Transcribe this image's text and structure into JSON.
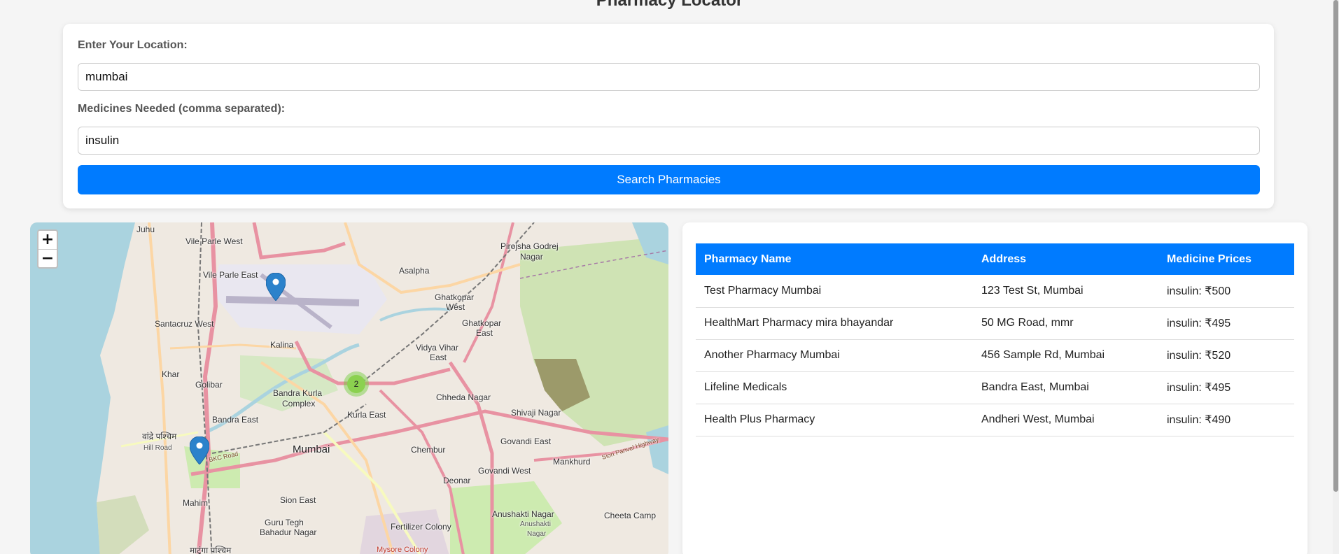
{
  "page": {
    "title": "Pharmacy Locator"
  },
  "form": {
    "location_label": "Enter Your Location:",
    "location_value": "mumbai",
    "medicines_label": "Medicines Needed (comma separated):",
    "medicines_value": "insulin",
    "search_button": "Search Pharmacies"
  },
  "map": {
    "zoom_in": "+",
    "zoom_out": "−",
    "cluster_count": "2",
    "marker_color": "#2b82cb",
    "labels": {
      "juhu": "Juhu",
      "vile_parle_west": "Vile Parle West",
      "vile_parle_east": "Vile Parle East",
      "santacruz_west": "Santacruz West",
      "kalina": "Kalina",
      "khar": "Khar",
      "golibar": "Golibar",
      "bandra_kurla": "Bandra Kurla",
      "complex": "Complex",
      "bandra_east": "Bandra East",
      "bandra_west_hindi": "वांद्रे पश्चिम",
      "hill_road": "Hill Road",
      "mumbai": "Mumbai",
      "kurla_east": "Kurla East",
      "chembur": "Chembur",
      "govandi_east": "Govandi East",
      "govandi_west": "Govandi West",
      "mankhurd": "Mankhurd",
      "deonar": "Deonar",
      "mahim": "Mahim",
      "sion_east": "Sion East",
      "guru_tegh": "Guru Tegh",
      "bahadur_nagar": "Bahadur Nagar",
      "matunga_west": "माटुंगा पश्चिम",
      "fertilizer_colony": "Fertilizer Colony",
      "anushakti_nagar": "Anushakti Nagar",
      "anushakti_nagar_small": "Anushakti",
      "anushakti_nagar_small2": "Nagar",
      "cheeta_camp": "Cheeta Camp",
      "asalpha": "Asalpha",
      "ghatkopar_west1": "Ghatkopar",
      "ghatkopar_west2": "West",
      "ghatkopar_east1": "Ghatkopar",
      "ghatkopar_east2": "East",
      "vidya_vihar1": "Vidya Vihar",
      "vidya_vihar2": "East",
      "chheda_nagar": "Chheda Nagar",
      "shivaji_nagar": "Shivaji Nagar",
      "pirojsha1": "Pirojsha Godrej",
      "pirojsha2": "Nagar",
      "sion_panvel": "Sion Panvel Highway",
      "bkc_road": "BKC Road",
      "mysore_colony": "Mysore Colony"
    }
  },
  "results": {
    "headers": [
      "Pharmacy Name",
      "Address",
      "Medicine Prices"
    ],
    "rows": [
      {
        "name": "Test Pharmacy Mumbai",
        "address": "123 Test St, Mumbai",
        "prices": "insulin: ₹500"
      },
      {
        "name": "HealthMart Pharmacy mira bhayandar",
        "address": "50 MG Road, mmr",
        "prices": "insulin: ₹495"
      },
      {
        "name": "Another Pharmacy Mumbai",
        "address": "456 Sample Rd, Mumbai",
        "prices": "insulin: ₹520"
      },
      {
        "name": "Lifeline Medicals",
        "address": "Bandra East, Mumbai",
        "prices": "insulin: ₹495"
      },
      {
        "name": "Health Plus Pharmacy",
        "address": "Andheri West, Mumbai",
        "prices": "insulin: ₹490"
      }
    ]
  },
  "colors": {
    "accent": "#007bff",
    "cluster": "#8bd14f",
    "water": "#aad3df",
    "park": "#cdebb0"
  }
}
